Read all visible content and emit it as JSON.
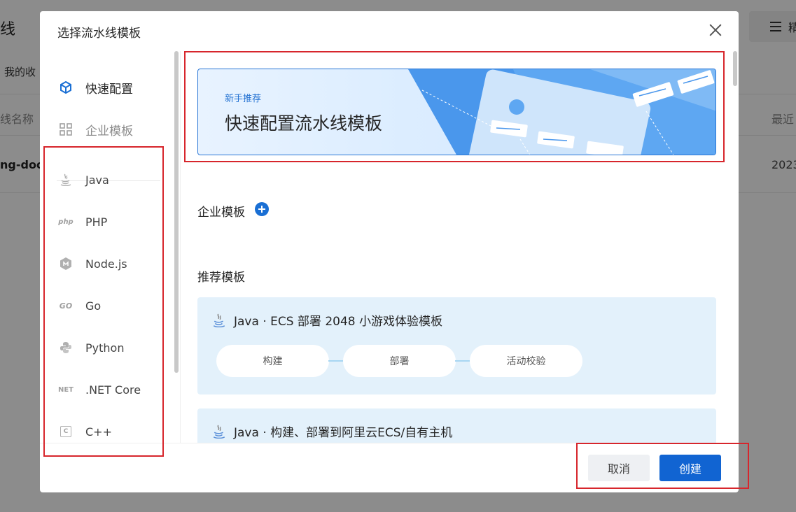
{
  "background": {
    "title": "线",
    "tab": "我的收",
    "col_name": "线名称",
    "col_recent": "最近",
    "row_name": "ng-doc",
    "row_date": "2023",
    "button_label": "精"
  },
  "modal": {
    "title": "选择流水线模板",
    "sidebar": {
      "quick_config": "快速配置",
      "enterprise_templates": "企业模板",
      "languages": [
        {
          "label": "Java",
          "icon": "java-icon"
        },
        {
          "label": "PHP",
          "icon": "php-icon",
          "glyph": "php"
        },
        {
          "label": "Node.js",
          "icon": "nodejs-icon"
        },
        {
          "label": "Go",
          "icon": "go-icon",
          "glyph": "GO"
        },
        {
          "label": "Python",
          "icon": "python-icon"
        },
        {
          "label": ".NET Core",
          "icon": "dotnet-icon",
          "glyph": "NET"
        },
        {
          "label": "C++",
          "icon": "cpp-icon",
          "glyph": "C"
        }
      ]
    },
    "banner": {
      "tag": "新手推荐",
      "title": "快速配置流水线模板"
    },
    "sections": {
      "enterprise": "企业模板",
      "recommended": "推荐模板"
    },
    "templates": [
      {
        "title": "Java · ECS 部署 2048 小游戏体验模板",
        "stages": [
          "构建",
          "部署",
          "活动校验"
        ]
      },
      {
        "title": "Java · 构建、部署到阿里云ECS/自有主机",
        "stages": []
      }
    ],
    "footer": {
      "cancel": "取消",
      "create": "创建"
    }
  },
  "colors": {
    "primary": "#1164d2",
    "annotation": "#d7262c",
    "card_bg": "#e3f1fb"
  }
}
